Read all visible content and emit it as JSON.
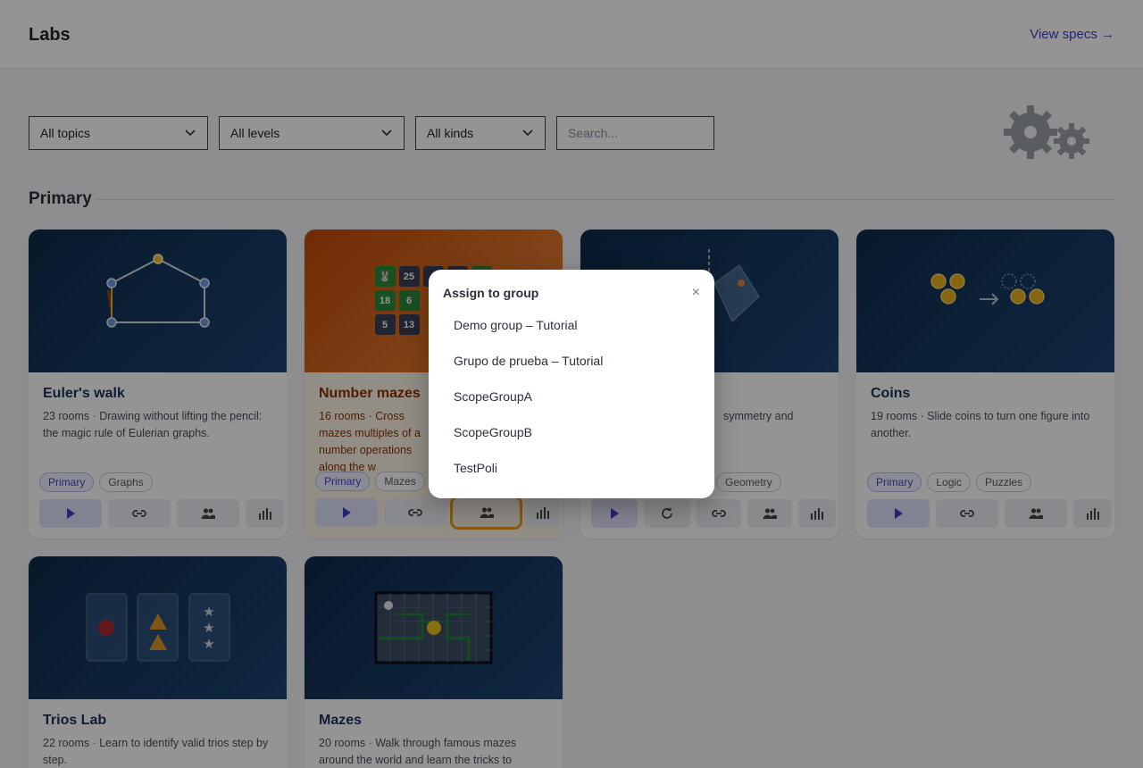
{
  "header": {
    "title": "Labs",
    "specs_link": "View specs →"
  },
  "filters": {
    "topics": "All topics",
    "levels": "All levels",
    "kinds": "All kinds",
    "search_placeholder": "Search..."
  },
  "section": {
    "title": "Primary"
  },
  "cards": [
    {
      "name": "Euler's walk",
      "desc": "23 rooms · Drawing without lifting the pencil: the magic rule of Eulerian graphs.",
      "tags": [
        "Primary",
        "Graphs"
      ]
    },
    {
      "name": "Number mazes",
      "desc": "16 rooms · Cross mazes multiples of a number operations along the w",
      "tags": [
        "Primary",
        "Mazes"
      ],
      "grid": [
        "25",
        "18",
        "6",
        "5",
        "13"
      ]
    },
    {
      "name": "",
      "desc_line1": "symmetry and",
      "tags": [
        "Geometry"
      ]
    },
    {
      "name": "Coins",
      "desc": "19 rooms · Slide coins to turn one figure into another.",
      "tags": [
        "Primary",
        "Logic",
        "Puzzles"
      ]
    },
    {
      "name": "Trios Lab",
      "desc": "22 rooms · Learn to identify valid trios step by step.",
      "tags": []
    },
    {
      "name": "Mazes",
      "desc": "20 rooms · Walk through famous mazes around the world and learn the tricks to",
      "tags": []
    }
  ],
  "modal": {
    "title": "Assign to group",
    "close": "×",
    "options": [
      "Demo group – Tutorial",
      "Grupo de prueba – Tutorial",
      "ScopeGroupA",
      "ScopeGroupB",
      "TestPoli"
    ]
  },
  "colors": {
    "accent": "#3b3fc9",
    "highlight": "#e89b1a",
    "hero": "#0f2a4a"
  }
}
